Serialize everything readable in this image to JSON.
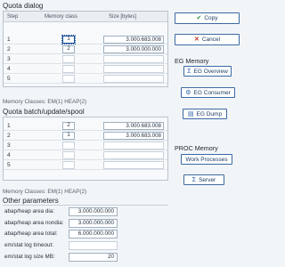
{
  "quota_dialog": {
    "title": "Quota dialog",
    "headers": {
      "step": "Step",
      "memory_class": "Memory class",
      "size": "Size [bytes]"
    },
    "rows": [
      {
        "step": "1",
        "memory_class": "1",
        "size": "3.000.683.008"
      },
      {
        "step": "2",
        "memory_class": "2",
        "size": "3.000.000.000"
      },
      {
        "step": "3",
        "memory_class": "",
        "size": ""
      },
      {
        "step": "4",
        "memory_class": "",
        "size": ""
      },
      {
        "step": "5",
        "memory_class": "",
        "size": ""
      }
    ],
    "memory_classes": "Memory Classes:  EM(1) HEAP(2)"
  },
  "quota_batch": {
    "title": "Quota batch/update/spool",
    "rows": [
      {
        "step": "1",
        "memory_class": "2",
        "size": "3.000.683.008"
      },
      {
        "step": "2",
        "memory_class": "1",
        "size": "3.000.683.008"
      },
      {
        "step": "3",
        "memory_class": "",
        "size": ""
      },
      {
        "step": "4",
        "memory_class": "",
        "size": ""
      },
      {
        "step": "5",
        "memory_class": "",
        "size": ""
      }
    ],
    "memory_classes": "Memory Classes:  EM(1) HEAP(2)"
  },
  "other_parameters": {
    "title": "Other parameters",
    "params": [
      {
        "label": "abap/heap area dia:",
        "value": "3.000.000.000"
      },
      {
        "label": "abap/heap area nondia:",
        "value": "3.000.000.000"
      },
      {
        "label": "abap/heap area total:",
        "value": "6.000.000.000"
      },
      {
        "label": "em/stat log timeout:",
        "value": ""
      },
      {
        "label": "em/stat log size MB:",
        "value": "20"
      }
    ]
  },
  "buttons": {
    "copy": "Copy",
    "cancel": "Cancel",
    "eg_memory_header": "EG Memory",
    "eg_overview": "EG Overview",
    "eg_consumer": "EG Consumer",
    "eg_dump": "EG Dump",
    "proc_memory_header": "PROC Memory",
    "work_processes": "Work Processes",
    "server": "Server"
  },
  "icons": {
    "copy": "checkmark-icon",
    "cancel": "x-icon",
    "eg_overview": "sigma-icon",
    "eg_consumer": "consumer-icon",
    "eg_dump": "dump-icon",
    "server": "sigma-icon"
  },
  "colors": {
    "accent": "#3b6aa3",
    "ok": "#2f8f3a",
    "cancel": "#c0392b"
  }
}
